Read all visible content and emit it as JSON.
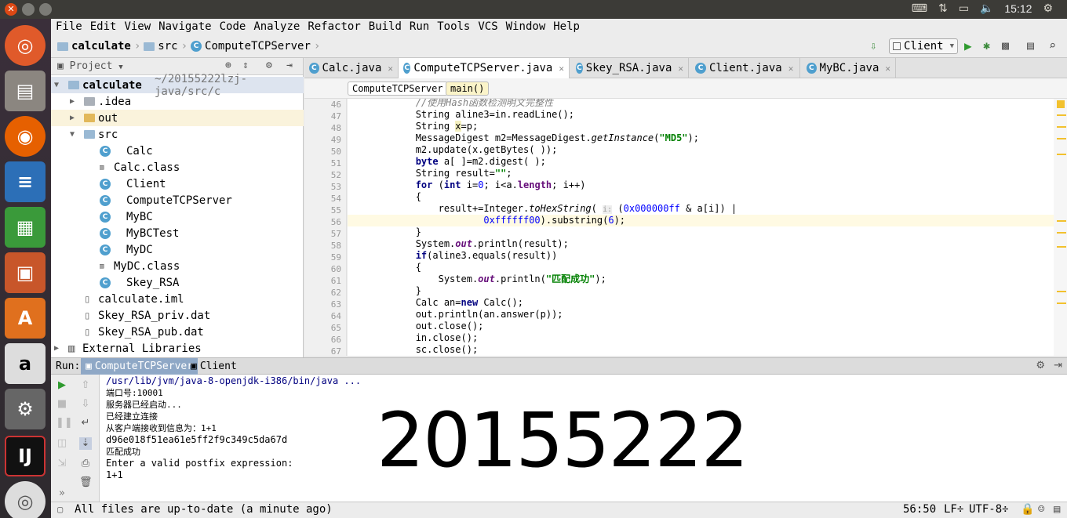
{
  "system": {
    "time": "15:12"
  },
  "menu": [
    "File",
    "Edit",
    "View",
    "Navigate",
    "Code",
    "Analyze",
    "Refactor",
    "Build",
    "Run",
    "Tools",
    "VCS",
    "Window",
    "Help"
  ],
  "breadcrumb": {
    "project": "calculate",
    "folder": "src",
    "file": "ComputeTCPServer"
  },
  "run_config": "Client",
  "project_panel": {
    "title": "Project",
    "root": "calculate",
    "root_path": "~/20155222lzj-java/src/c",
    "items": [
      ".idea",
      "out",
      "src",
      "Calc",
      "Calc.class",
      "Client",
      "ComputeTCPServer",
      "MyBC",
      "MyBCTest",
      "MyDC",
      "MyDC.class",
      "Skey_RSA",
      "calculate.iml",
      "Skey_RSA_priv.dat",
      "Skey_RSA_pub.dat",
      "External Libraries"
    ]
  },
  "editor_tabs": [
    "Calc.java",
    "ComputeTCPServer.java",
    "Skey_RSA.java",
    "Client.java",
    "MyBC.java"
  ],
  "editor_crumbs": [
    "ComputeTCPServer",
    "main()"
  ],
  "code_lines": [
    "46",
    "47",
    "48",
    "49",
    "50",
    "51",
    "52",
    "53",
    "54",
    "55",
    "56",
    "57",
    "58",
    "59",
    "60",
    "61",
    "62",
    "63",
    "64",
    "65",
    "66",
    "67"
  ],
  "run_panel": {
    "label": "Run:",
    "tabs": [
      "ComputeTCPServer",
      "Client"
    ],
    "console": [
      "/usr/lib/jvm/java-8-openjdk-i386/bin/java ...",
      "端口号:10001",
      "服务器已经启动...",
      "已经建立连接",
      "从客户端接收到信息为：1+1",
      "d96e018f51ea61e5ff2f9c349c5da67d",
      "匹配成功",
      "Enter a valid postfix expression:",
      "1+1"
    ]
  },
  "overlay_text": "20155222",
  "statusbar": {
    "message": "All files are up-to-date (a minute ago)",
    "position": "56:50",
    "line_sep": "LF÷",
    "encoding": "UTF-8÷"
  }
}
